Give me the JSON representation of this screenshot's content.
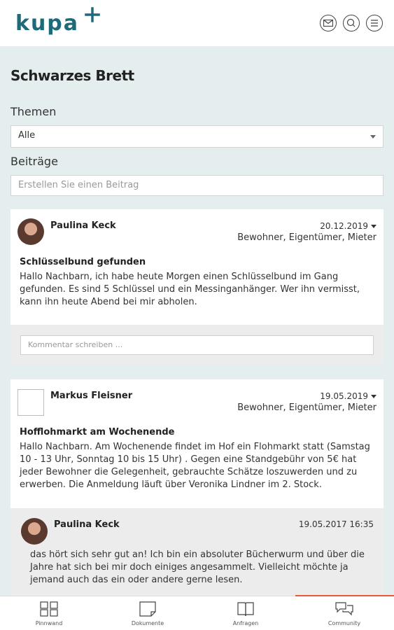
{
  "header": {
    "logo_text": "kupa",
    "icons": [
      "mail-icon",
      "chat-icon",
      "menu-icon"
    ]
  },
  "page": {
    "title": "Schwarzes Brett",
    "themes_label": "Themen",
    "themes_selected": "Alle",
    "posts_label": "Beiträge",
    "create_placeholder": "Erstellen Sie einen Beitrag"
  },
  "posts": [
    {
      "author": "Paulina Keck",
      "date": "20.12.2019",
      "roles": "Bewohner, Eigentümer, Mieter",
      "title": "Schlüsselbund gefunden",
      "body": "Hallo Nachbarn, ich habe heute Morgen einen Schlüsselbund im Gang gefunden. Es sind 5 Schlüssel und ein Messinganhänger. Wer ihn vermisst, kann ihn heute Abend bei mir abholen.",
      "comment_placeholder": "Kommentar schreiben ..."
    },
    {
      "author": "Markus Fleisner",
      "date": "19.05.2019",
      "roles": "Bewohner, Eigentümer, Mieter",
      "title": "Hofflohmarkt am Wochenende",
      "body": "Hallo Nachbarn. Am Wochenende findet im Hof ein Flohmarkt statt (Samstag 10 - 13 Uhr, Sonntag 10 bis 15 Uhr) . Gegen eine Standgebühr von 5€ hat jeder Bewohner die Gelegenheit, gebrauchte Schätze loszuwerden und zu erwerben. Die Anmeldung läuft über Veronika Lindner im 2. Stock.",
      "comment": {
        "author": "Paulina Keck",
        "date": "19.05.2017 16:35",
        "body": "das hört sich sehr gut an! Ich bin ein absoluter Bücherwurm und über die Jahre hat sich bei mir doch einiges angesammelt. Vielleicht möchte ja jemand auch das ein oder andere gerne lesen."
      }
    }
  ],
  "nav": [
    {
      "label": "Pinnwand",
      "icon": "grid-icon"
    },
    {
      "label": "Dokumente",
      "icon": "document-icon"
    },
    {
      "label": "Anfragen",
      "icon": "book-icon"
    },
    {
      "label": "Community",
      "icon": "chat-bubbles-icon",
      "active": true
    }
  ],
  "colors": {
    "brand": "#1f6a7a",
    "background": "#e4eeee",
    "active_nav": "#e8593c"
  }
}
